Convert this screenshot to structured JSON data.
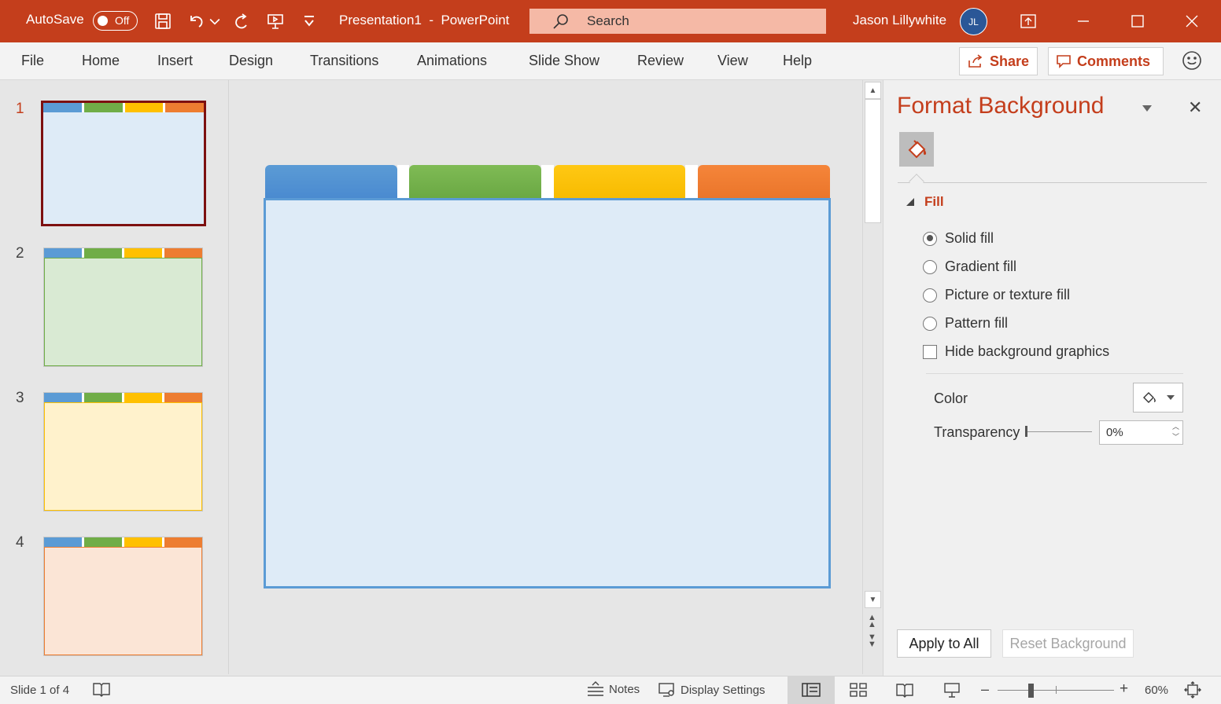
{
  "titlebar": {
    "autosave_label": "AutoSave",
    "autosave_state": "Off",
    "document_title": "Presentation1  -  PowerPoint",
    "search_placeholder": "Search",
    "user_name": "Jason Lillywhite",
    "user_initials": "JL"
  },
  "ribbon": {
    "tabs": [
      "File",
      "Home",
      "Insert",
      "Design",
      "Transitions",
      "Animations",
      "Slide Show",
      "Review",
      "View",
      "Help"
    ],
    "share_label": "Share",
    "comments_label": "Comments"
  },
  "thumbnails": {
    "numbers": [
      "1",
      "2",
      "3",
      "4"
    ],
    "body_colors": [
      "#deebf7",
      "#d9ead3",
      "#fff2cc",
      "#fbe5d6"
    ],
    "active_index": 0
  },
  "slide": {
    "tab_colors": [
      "#5b9bd5",
      "#70ad47",
      "#ffc000",
      "#ed7d31"
    ],
    "body_color": "#deebf7",
    "border_color": "#5b9bd5"
  },
  "format_pane": {
    "title": "Format Background",
    "section_label": "Fill",
    "options": {
      "solid": "Solid fill",
      "gradient": "Gradient fill",
      "picture": "Picture or texture fill",
      "pattern": "Pattern fill",
      "hide_graphics": "Hide background graphics"
    },
    "selected_option": "solid",
    "color_label": "Color",
    "transparency_label": "Transparency",
    "transparency_value": "0%",
    "apply_all_label": "Apply to All",
    "reset_label": "Reset Background"
  },
  "statusbar": {
    "slide_info": "Slide 1 of 4",
    "notes_label": "Notes",
    "display_settings_label": "Display Settings",
    "zoom_minus": "–",
    "zoom_plus": "+",
    "zoom_level": "60%"
  },
  "colors": {
    "accent": "#c43e1c",
    "search_bg": "#f5b9a6",
    "avatar": "#2b5797"
  }
}
